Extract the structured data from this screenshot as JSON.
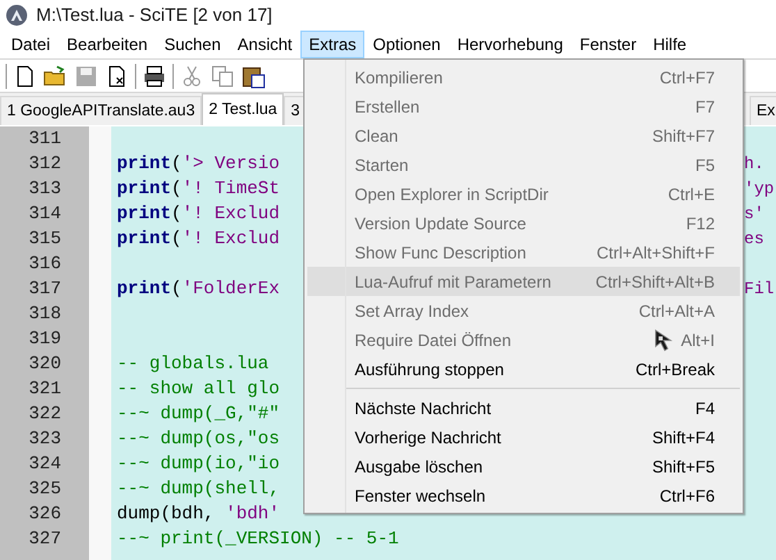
{
  "window": {
    "title": "M:\\Test.lua - SciTE [2 von 17]"
  },
  "menubar": [
    {
      "label": "Datei",
      "selected": false
    },
    {
      "label": "Bearbeiten",
      "selected": false
    },
    {
      "label": "Suchen",
      "selected": false
    },
    {
      "label": "Ansicht",
      "selected": false
    },
    {
      "label": "Extras",
      "selected": true
    },
    {
      "label": "Optionen",
      "selected": false
    },
    {
      "label": "Hervorhebung",
      "selected": false
    },
    {
      "label": "Fenster",
      "selected": false
    },
    {
      "label": "Hilfe",
      "selected": false
    }
  ],
  "tabs": [
    {
      "label": "1 GoogleAPITranslate.au3",
      "selected": false
    },
    {
      "label": "2 Test.lua",
      "selected": true
    },
    {
      "label": "3",
      "selected": false
    },
    {
      "label": "Ex",
      "selected": false
    }
  ],
  "editor": {
    "lines": [
      {
        "number": "311"
      },
      {
        "number": "312",
        "segments": [
          {
            "text": "print",
            "kind": "keyword"
          },
          {
            "text": "(",
            "kind": "plain"
          },
          {
            "text": "'> Versio",
            "kind": "string"
          }
        ],
        "overflow": "h."
      },
      {
        "number": "313",
        "segments": [
          {
            "text": "print",
            "kind": "keyword"
          },
          {
            "text": "(",
            "kind": "plain"
          },
          {
            "text": "'! TimeSt",
            "kind": "string"
          }
        ],
        "overflow": "'yp"
      },
      {
        "number": "314",
        "segments": [
          {
            "text": "print",
            "kind": "keyword"
          },
          {
            "text": "(",
            "kind": "plain"
          },
          {
            "text": "'! Exclud",
            "kind": "string"
          }
        ],
        "overflow": "s'"
      },
      {
        "number": "315",
        "segments": [
          {
            "text": "print",
            "kind": "keyword"
          },
          {
            "text": "(",
            "kind": "plain"
          },
          {
            "text": "'! Exclud",
            "kind": "string"
          }
        ],
        "overflow": "es"
      },
      {
        "number": "316"
      },
      {
        "number": "317",
        "segments": [
          {
            "text": "print",
            "kind": "keyword"
          },
          {
            "text": "(",
            "kind": "plain"
          },
          {
            "text": "'FolderEx",
            "kind": "string"
          }
        ],
        "overflow": "Fil"
      },
      {
        "number": "318"
      },
      {
        "number": "319"
      },
      {
        "number": "320",
        "segments": [
          {
            "text": "-- globals.lua",
            "kind": "comment"
          }
        ]
      },
      {
        "number": "321",
        "segments": [
          {
            "text": "-- show all glo",
            "kind": "comment"
          }
        ]
      },
      {
        "number": "322",
        "segments": [
          {
            "text": "--~ dump(_G,\"#\"",
            "kind": "comment"
          }
        ]
      },
      {
        "number": "323",
        "segments": [
          {
            "text": "--~ dump(os,\"os",
            "kind": "comment"
          }
        ]
      },
      {
        "number": "324",
        "segments": [
          {
            "text": "--~ dump(io,\"io",
            "kind": "comment"
          }
        ]
      },
      {
        "number": "325",
        "segments": [
          {
            "text": "--~ dump(shell,",
            "kind": "comment"
          }
        ]
      },
      {
        "number": "326",
        "segments": [
          {
            "text": "dump(bdh, ",
            "kind": "plain"
          },
          {
            "text": "'bdh'",
            "kind": "string"
          }
        ]
      },
      {
        "number": "327",
        "segments": [
          {
            "text": "--~ print(_VERSION) -- 5-1",
            "kind": "comment"
          }
        ]
      }
    ]
  },
  "menu": [
    {
      "kind": "item",
      "label": "Kompilieren",
      "shortcut": "Ctrl+F7",
      "disabled": true,
      "highlighted": false
    },
    {
      "kind": "item",
      "label": "Erstellen",
      "shortcut": "F7",
      "disabled": true,
      "highlighted": false
    },
    {
      "kind": "item",
      "label": "Clean",
      "shortcut": "Shift+F7",
      "disabled": true,
      "highlighted": false
    },
    {
      "kind": "item",
      "label": "Starten",
      "shortcut": "F5",
      "disabled": true,
      "highlighted": false
    },
    {
      "kind": "item",
      "label": "Open Explorer in ScriptDir",
      "shortcut": "Ctrl+E",
      "disabled": true,
      "highlighted": false
    },
    {
      "kind": "item",
      "label": "Version Update Source",
      "shortcut": "F12",
      "disabled": true,
      "highlighted": false
    },
    {
      "kind": "item",
      "label": "Show Func Description",
      "shortcut": "Ctrl+Alt+Shift+F",
      "disabled": true,
      "highlighted": false
    },
    {
      "kind": "item",
      "label": "Lua-Aufruf mit Parametern",
      "shortcut": "Ctrl+Shift+Alt+B",
      "disabled": true,
      "highlighted": true
    },
    {
      "kind": "item",
      "label": "Set Array Index",
      "shortcut": "Ctrl+Alt+A",
      "disabled": true,
      "highlighted": false
    },
    {
      "kind": "item",
      "label": "Require Datei Öffnen",
      "shortcut": "Alt+I",
      "disabled": true,
      "highlighted": false
    },
    {
      "kind": "item",
      "label": "Ausführung stoppen",
      "shortcut": "Ctrl+Break",
      "disabled": false,
      "highlighted": false
    },
    {
      "kind": "separator"
    },
    {
      "kind": "item",
      "label": "Nächste Nachricht",
      "shortcut": "F4",
      "disabled": false,
      "highlighted": false
    },
    {
      "kind": "item",
      "label": "Vorherige Nachricht",
      "shortcut": "Shift+F4",
      "disabled": false,
      "highlighted": false
    },
    {
      "kind": "item",
      "label": "Ausgabe löschen",
      "shortcut": "Shift+F5",
      "disabled": false,
      "highlighted": false
    },
    {
      "kind": "item",
      "label": "Fenster wechseln",
      "shortcut": "Ctrl+F6",
      "disabled": false,
      "highlighted": false
    }
  ]
}
